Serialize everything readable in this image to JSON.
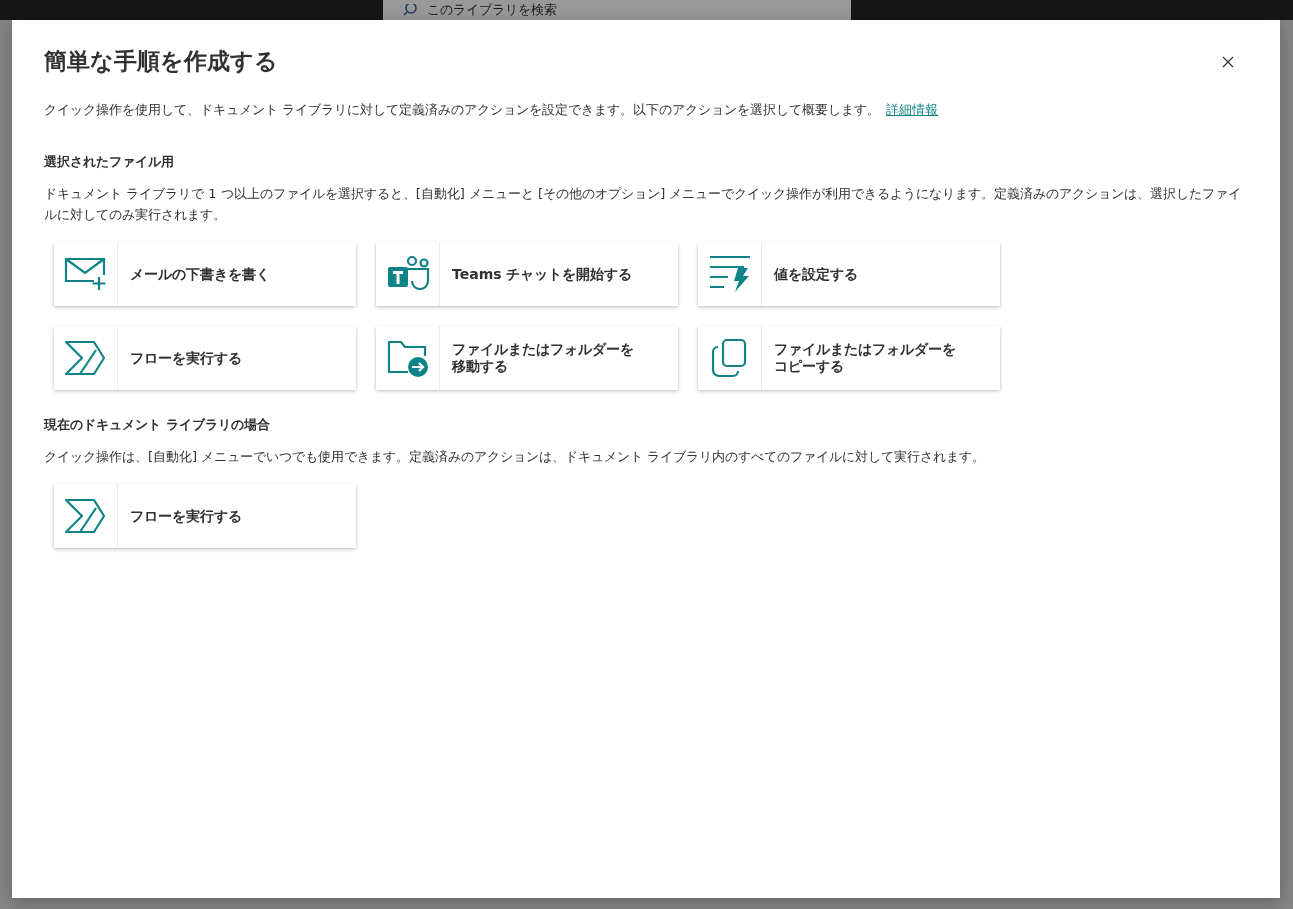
{
  "background": {
    "search": {
      "placeholder": "このライブラリを検索"
    }
  },
  "dialog": {
    "title": "簡単な手順を作成する",
    "intro": "クイック操作を使用して、ドキュメント ライブラリに対して定義済みのアクションを設定できます。以下のアクションを選択して概要します。",
    "link": "詳細情報",
    "sections": [
      {
        "heading": "選択されたファイル用",
        "description": "ドキュメント ライブラリで 1 つ以上のファイルを選択すると、[自動化] メニューと [その他のオプション] メニューでクイック操作が利用できるようになります。定義済みのアクションは、選択したファイルに対してのみ実行されます。",
        "actions": [
          {
            "kind": "mail",
            "label": "メールの下書きを書く"
          },
          {
            "kind": "chat",
            "label": "Teams チャットを開始する"
          },
          {
            "kind": "setvalue",
            "label": "値を設定する"
          },
          {
            "kind": "flow",
            "label": "フローを実行する"
          },
          {
            "kind": "move",
            "label": "ファイルまたはフォルダーを移動する"
          },
          {
            "kind": "copy",
            "label": "ファイルまたはフォルダーをコピーする"
          }
        ]
      },
      {
        "heading": "現在のドキュメント ライブラリの場合",
        "description": "クイック操作は、[自動化] メニューでいつでも使用できます。定義済みのアクションは、ドキュメント ライブラリ内のすべてのファイルに対して実行されます。",
        "actions": [
          {
            "kind": "flow",
            "label": "フローを実行する"
          }
        ]
      }
    ]
  }
}
